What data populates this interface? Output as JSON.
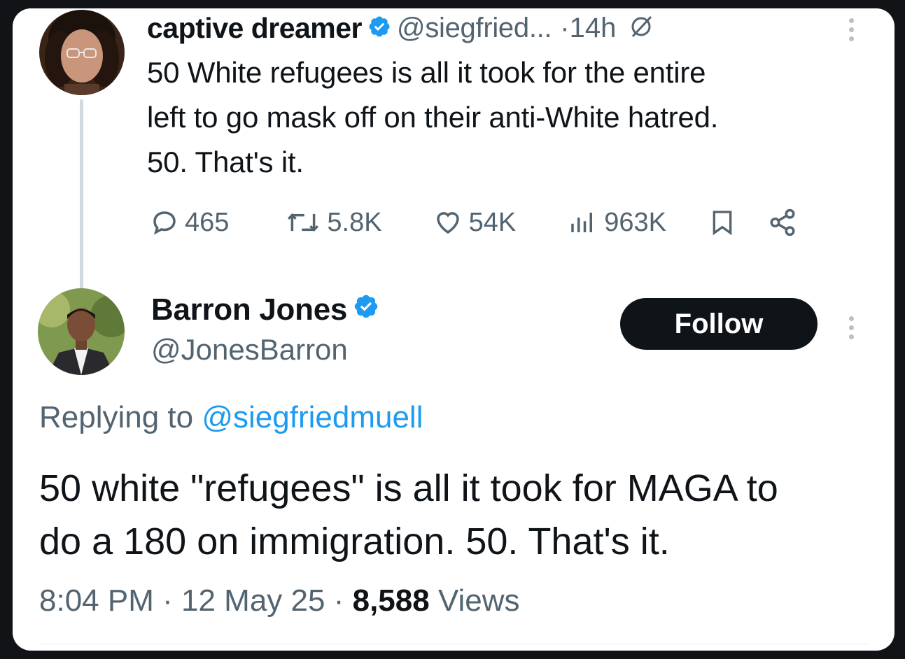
{
  "tweet": {
    "author_name": "captive dreamer",
    "author_handle": "@siegfried...",
    "separator": "·",
    "time": "14h",
    "text_lines": [
      "50 White refugees is all it took for the entire",
      "left to go mask off on their anti-White hatred.",
      "50.  That's it."
    ],
    "stats": {
      "replies": "465",
      "reposts": "5.8K",
      "likes": "54K",
      "views": "963K"
    },
    "icons": [
      "verified-badge-icon",
      "muted-icon",
      "more-icon",
      "reply-icon",
      "repost-icon",
      "like-icon",
      "views-icon",
      "bookmark-icon",
      "share-icon"
    ]
  },
  "reply": {
    "author_name": "Barron Jones",
    "author_handle": "@JonesBarron",
    "follow_label": "Follow",
    "replying_to_prefix": "Replying to ",
    "replying_to_handle": "@siegfriedmuell",
    "text_lines": [
      "50 white \"refugees\" is all it took for MAGA to",
      "do a 180 on immigration. 50. That's it."
    ],
    "time": "8:04 PM",
    "date": "12 May 25",
    "separator": "·",
    "views_count": "8,588",
    "views_label": "Views"
  },
  "colors": {
    "verified_blue": "#1d9bf0",
    "mention_blue": "#1d9bf0",
    "text_primary": "#0f1419",
    "text_secondary": "#536471",
    "follow_button_bg": "#0f1419"
  }
}
